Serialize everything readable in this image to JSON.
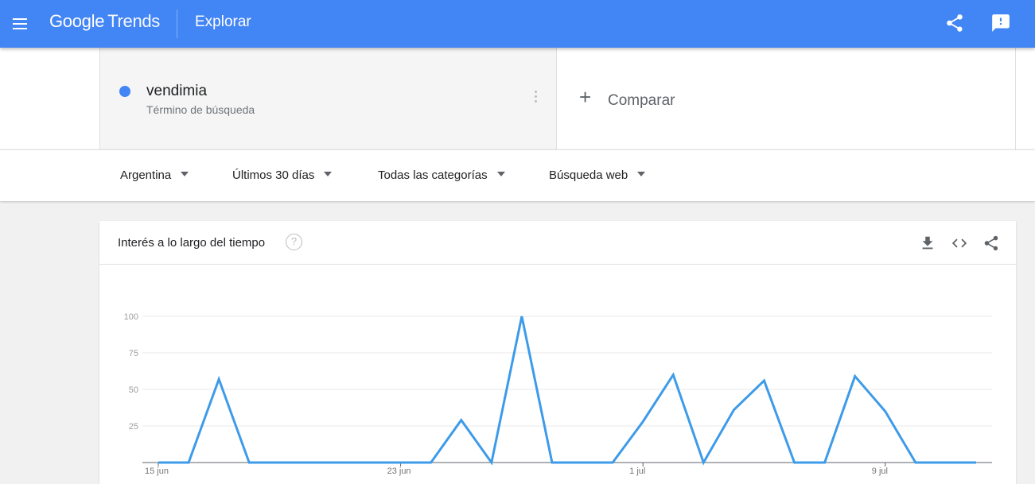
{
  "topbar": {
    "brand": "Google",
    "product": "Trends",
    "page": "Explorar",
    "icons": [
      "menu-icon",
      "share-icon",
      "feedback-icon"
    ]
  },
  "term": {
    "name": "vendimia",
    "type": "Término de búsqueda",
    "color": "#4285f4"
  },
  "compare": {
    "plus": "+",
    "label": "Comparar"
  },
  "filters": {
    "country": "Argentina",
    "time": "Últimos 30 días",
    "category": "Todas las categorías",
    "search_type": "Búsqueda web"
  },
  "card": {
    "title": "Interés a lo largo del tiempo",
    "help": "?"
  },
  "chart_data": {
    "type": "line",
    "title": "",
    "xlabel": "",
    "ylabel": "",
    "ylim": [
      0,
      100
    ],
    "yticks": [
      25,
      50,
      75,
      100
    ],
    "x": [
      "15 jun",
      "16 jun",
      "17 jun",
      "18 jun",
      "19 jun",
      "20 jun",
      "21 jun",
      "22 jun",
      "23 jun",
      "24 jun",
      "25 jun",
      "26 jun",
      "27 jun",
      "28 jun",
      "29 jun",
      "30 jun",
      "1 jul",
      "2 jul",
      "3 jul",
      "4 jul",
      "5 jul",
      "6 jul",
      "7 jul",
      "8 jul",
      "9 jul",
      "10 jul",
      "11 jul",
      "12 jul"
    ],
    "xtick_labels": [
      "15 jun",
      "23 jun",
      "1 jul",
      "9 jul"
    ],
    "series": [
      {
        "name": "vendimia",
        "color": "#3d9be9",
        "values": [
          0,
          0,
          57,
          0,
          0,
          0,
          0,
          0,
          0,
          0,
          29,
          0,
          100,
          0,
          0,
          0,
          28,
          60,
          0,
          36,
          56,
          0,
          0,
          59,
          35,
          0,
          0,
          0
        ]
      }
    ],
    "grid": true
  }
}
